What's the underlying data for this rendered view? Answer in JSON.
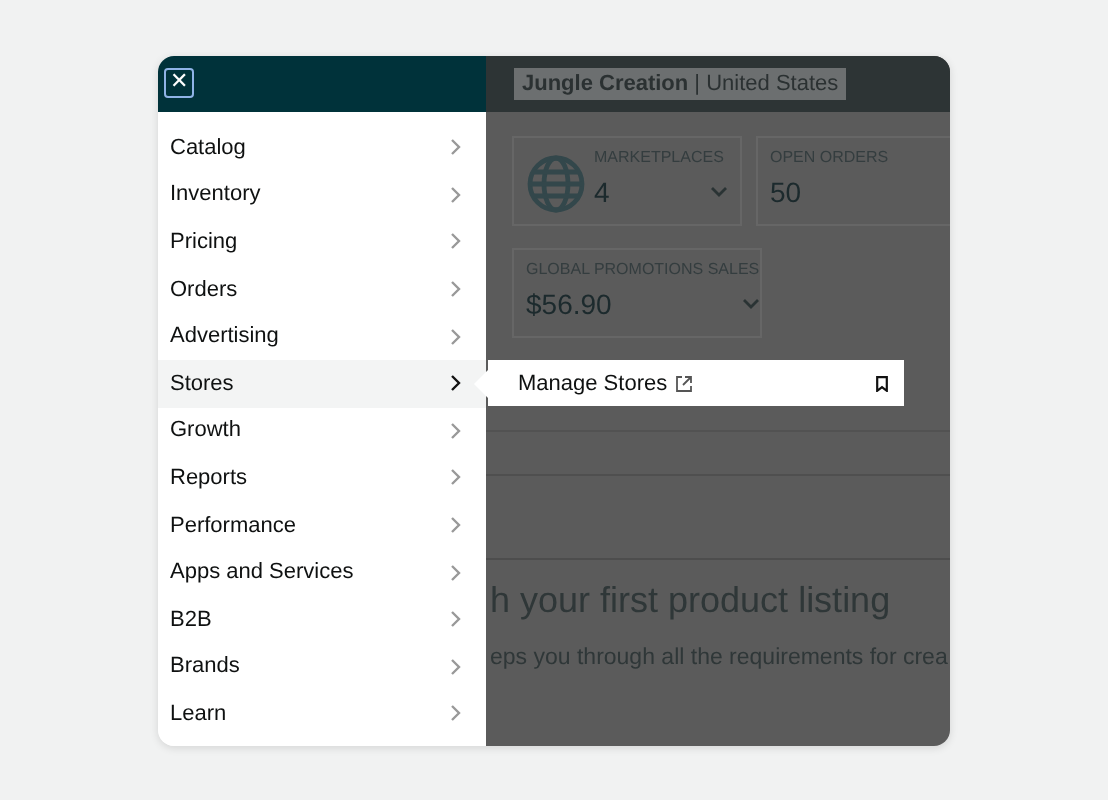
{
  "menu": {
    "close_label": "✕",
    "items": [
      {
        "label": "Catalog",
        "selected": false
      },
      {
        "label": "Inventory",
        "selected": false
      },
      {
        "label": "Pricing",
        "selected": false
      },
      {
        "label": "Orders",
        "selected": false
      },
      {
        "label": "Advertising",
        "selected": false
      },
      {
        "label": "Stores",
        "selected": true,
        "submenu": [
          {
            "label": "Manage Stores",
            "external": true,
            "bookmark": true
          }
        ]
      },
      {
        "label": "Growth",
        "selected": false
      },
      {
        "label": "Reports",
        "selected": false
      },
      {
        "label": "Performance",
        "selected": false
      },
      {
        "label": "Apps and Services",
        "selected": false
      },
      {
        "label": "B2B",
        "selected": false
      },
      {
        "label": "Brands",
        "selected": false
      },
      {
        "label": "Learn",
        "selected": false
      }
    ]
  },
  "dashboard": {
    "account": "**Jungle Creation** | United States",
    "cards": [
      {
        "label": "MARKETPLACES",
        "value": "4",
        "dropdown": true
      },
      {
        "label": "OPEN ORDERS",
        "value": "50",
        "dropdown": false
      },
      {
        "label": "GLOBAL PROMOTIONS SALES",
        "value": "$56.90",
        "dropdown": true
      }
    ],
    "heading": "h your first product listing",
    "text": "eps you through all the requirements for crea"
  }
}
